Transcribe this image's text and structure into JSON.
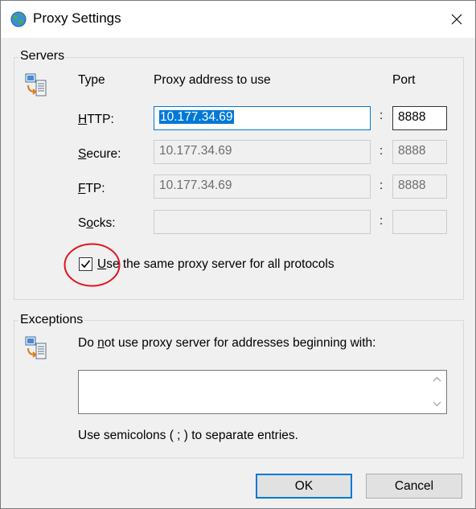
{
  "window": {
    "title": "Proxy Settings"
  },
  "servers": {
    "title": "Servers",
    "col_type": "Type",
    "col_address": "Proxy address to use",
    "col_port": "Port",
    "rows": [
      {
        "label": "HTTP:",
        "mnemonic": "H",
        "rest": "TTP:",
        "address": "10.177.34.69",
        "port": "8888",
        "enabled": true
      },
      {
        "label": "Secure:",
        "mnemonic": "S",
        "rest": "ecure:",
        "address": "10.177.34.69",
        "port": "8888",
        "enabled": false
      },
      {
        "label": "FTP:",
        "mnemonic": "F",
        "rest": "TP:",
        "address": "10.177.34.69",
        "port": "8888",
        "enabled": false
      },
      {
        "label": "Socks:",
        "mnemonic_pre": "S",
        "mnemonic": "o",
        "rest": "cks:",
        "address": "",
        "port": "",
        "enabled": false
      }
    ],
    "same_proxy": {
      "mnemonic": "U",
      "rest": "se the same proxy server for all protocols",
      "checked": true
    },
    "colon": ":"
  },
  "exceptions": {
    "title": "Exceptions",
    "instruction_pre": "Do ",
    "instruction_mnemonic": "n",
    "instruction_post": "ot use proxy server for addresses beginning with:",
    "value": "",
    "hint": "Use semicolons ( ; ) to separate entries."
  },
  "buttons": {
    "ok": "OK",
    "cancel": "Cancel"
  },
  "colors": {
    "accent": "#0078d7",
    "annotation": "#e0141e"
  }
}
